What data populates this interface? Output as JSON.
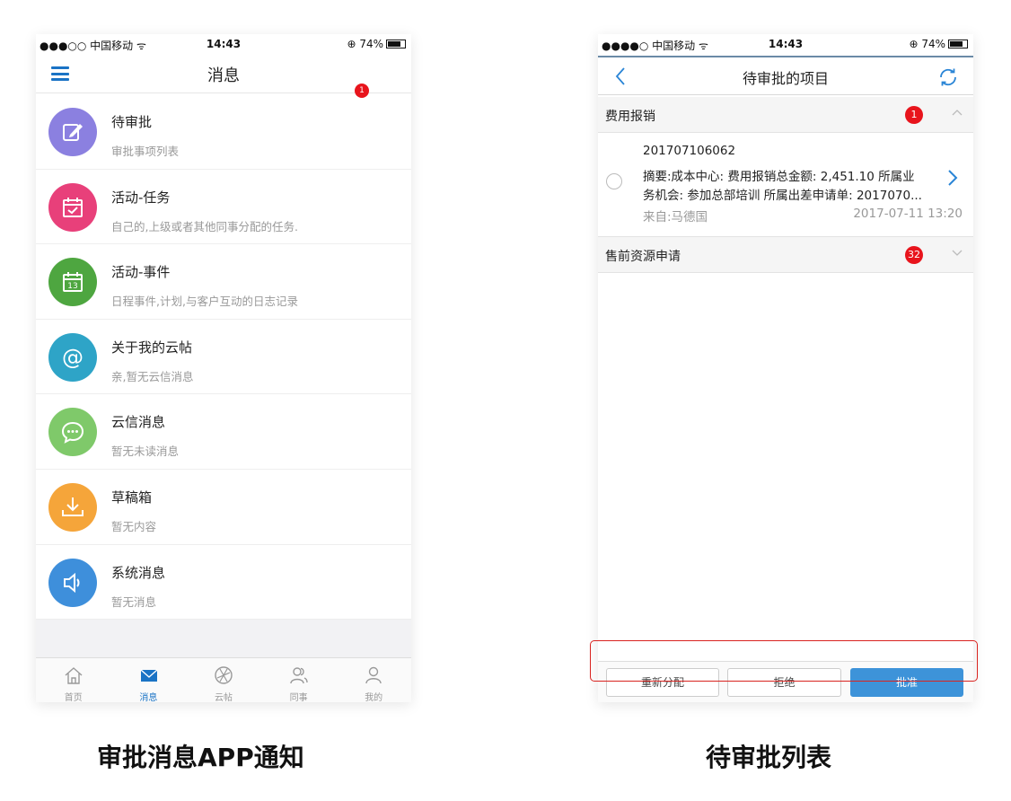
{
  "statusbar": {
    "carrier": "●●●○○ 中国移动 ᯤ",
    "time": "14:43",
    "battery": "⊕ 74%"
  },
  "statusbar2": {
    "carrier": "●●●●○ 中国移动 ᯤ",
    "time": "14:43",
    "battery": "⊕ 74%"
  },
  "messages_screen": {
    "title": "消息",
    "notification_count": "1",
    "items": [
      {
        "title": "待审批",
        "subtitle": "审批事项列表",
        "icon": "edit-icon",
        "color": "#8b80e0"
      },
      {
        "title": "活动-任务",
        "subtitle": "自己的,上级或者其他同事分配的任务.",
        "icon": "calendar-check-icon",
        "color": "#e8407a"
      },
      {
        "title": "活动-事件",
        "subtitle": "日程事件,计划,与客户互动的日志记录",
        "icon": "calendar-13-icon",
        "color": "#4ea640"
      },
      {
        "title": "关于我的云帖",
        "subtitle": "亲,暂无云信消息",
        "icon": "at-icon",
        "color": "#2ea4c7"
      },
      {
        "title": "云信消息",
        "subtitle": "暂无未读消息",
        "icon": "chat-icon",
        "color": "#7fc96a"
      },
      {
        "title": "草稿箱",
        "subtitle": "暂无内容",
        "icon": "download-icon",
        "color": "#f5a53a"
      },
      {
        "title": "系统消息",
        "subtitle": "暂无消息",
        "icon": "speaker-icon",
        "color": "#3e8fdb"
      }
    ],
    "tabs": [
      {
        "label": "首页",
        "icon": "home-icon"
      },
      {
        "label": "消息",
        "icon": "mail-icon"
      },
      {
        "label": "云帖",
        "icon": "aperture-icon"
      },
      {
        "label": "同事",
        "icon": "colleagues-icon"
      },
      {
        "label": "我的",
        "icon": "person-icon"
      }
    ]
  },
  "approval_screen": {
    "title": "待审批的项目",
    "sections": [
      {
        "title": "费用报销",
        "count": "1"
      },
      {
        "title": "售前资源申请",
        "count": "32"
      }
    ],
    "record": {
      "id": "201707106062",
      "line1": "摘要:成本中心:  费用报销总金额: 2,451.10  所属业",
      "line2": "务机会: 参加总部培训  所属出差申请单: 2017070...",
      "from": "来自:马德国",
      "date": "2017-07-11 13:20"
    },
    "actions": {
      "reassign": "重新分配",
      "reject": "拒绝",
      "approve": "批准"
    }
  },
  "captions": {
    "left": "审批消息APP通知",
    "right": "待审批列表"
  }
}
